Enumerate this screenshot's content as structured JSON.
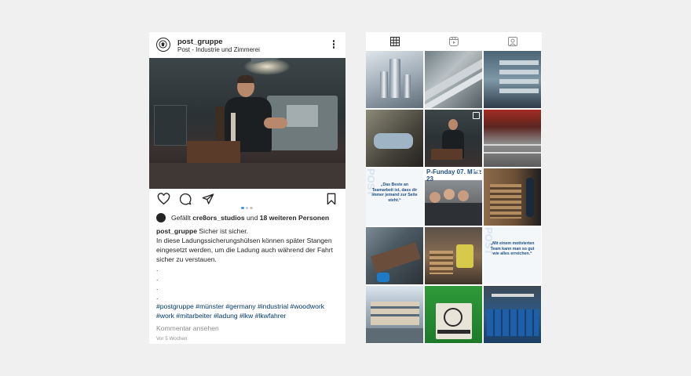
{
  "post": {
    "username": "post_gruppe",
    "subtitle": "Post - Industrie und Zimmerei",
    "likes_prefix": "Gefällt ",
    "likes_user": "cre8ors_studios",
    "likes_mid": " und ",
    "likes_count": "18 weiteren Personen",
    "caption_user": "post_gruppe",
    "caption_line1": " Sicher ist sicher.",
    "caption_line2": "In diese Ladungssicherungshülsen können später Stangen eingesetzt werden, um die Ladung auch während der Fahrt sicher zu verstauen.",
    "dot1": ".",
    "dot2": ".",
    "dot3": ".",
    "dot4": ".",
    "hashtags": "#postgruppe #münster #germany #industrial #woodwork #work #mitarbeiter #ladung #lkw #lkwfahrer",
    "comments_link": "Kommentar ansehen",
    "time": "Vor 5 Wochen",
    "carousel": {
      "count": 3,
      "active": 1
    }
  },
  "profile": {
    "tabs": [
      {
        "icon": "grid-icon",
        "active": true
      },
      {
        "icon": "reels-icon",
        "active": false
      },
      {
        "icon": "tagged-icon",
        "active": false
      }
    ],
    "grid_text": {
      "quote1": "„Das Beste an Teamarbeit ist, dass dir immer jemand zur Seite steht.“",
      "date_banner": "P-Funday 07. März 23",
      "quote2": "„Mit einem motivierten Team kann man so gut wie alles erreichen.“",
      "brand_side": "POST"
    }
  },
  "colors": {
    "background": "#f0f0f0",
    "card": "#ffffff",
    "text": "#262626",
    "link": "#00376b",
    "muted": "#8e8e8e",
    "carousel_active": "#3897f0"
  }
}
